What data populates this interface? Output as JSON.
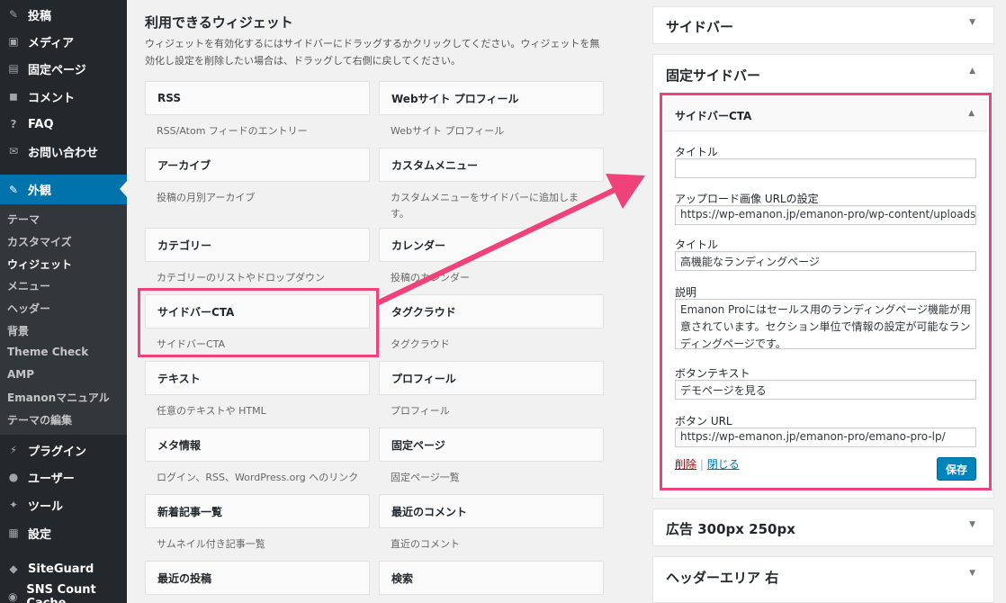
{
  "admin_menu": {
    "items": [
      {
        "icon": "pin-icon",
        "glyph": "✎",
        "label": "投稿"
      },
      {
        "icon": "media-icon",
        "glyph": "▣",
        "label": "メディア"
      },
      {
        "icon": "page-icon",
        "glyph": "▤",
        "label": "固定ページ"
      },
      {
        "icon": "comment-icon",
        "glyph": "◼",
        "label": "コメント"
      },
      {
        "icon": "help-icon",
        "glyph": "?",
        "label": "FAQ"
      },
      {
        "icon": "mail-icon",
        "glyph": "✉",
        "label": "お問い合わせ"
      },
      {
        "icon": "appearance-icon",
        "glyph": "✎",
        "label": "外観"
      },
      {
        "icon": "plugin-icon",
        "glyph": "⚡",
        "label": "プラグイン"
      },
      {
        "icon": "user-icon",
        "glyph": "●",
        "label": "ユーザー"
      },
      {
        "icon": "tool-icon",
        "glyph": "✦",
        "label": "ツール"
      },
      {
        "icon": "settings-icon",
        "glyph": "▦",
        "label": "設定"
      },
      {
        "icon": "siteguard-icon",
        "glyph": "◆",
        "label": "SiteGuard"
      },
      {
        "icon": "sns-icon",
        "glyph": "◉",
        "label": "SNS Count Cache"
      }
    ],
    "submenu": [
      "テーマ",
      "カスタマイズ",
      "ウィジェット",
      "メニュー",
      "ヘッダー",
      "背景",
      "Theme Check",
      "AMP",
      "Emanonマニュアル",
      "テーマの編集"
    ]
  },
  "available": {
    "title": "利用できるウィジェット",
    "description": "ウィジェットを有効化するにはサイドバーにドラッグするかクリックしてください。ウィジェットを無効化し設定を削除したい場合は、ドラッグして右側に戻してください。",
    "widgets": [
      {
        "name": "RSS",
        "desc": "RSS/Atom フィードのエントリー"
      },
      {
        "name": "Webサイト プロフィール",
        "desc": "Webサイト プロフィール"
      },
      {
        "name": "アーカイブ",
        "desc": "投稿の月別アーカイブ"
      },
      {
        "name": "カスタムメニュー",
        "desc": "カスタムメニューをサイドバーに追加しま す。"
      },
      {
        "name": "カテゴリー",
        "desc": "カテゴリーのリストやドロップダウン"
      },
      {
        "name": "カレンダー",
        "desc": "投稿のカレンダー"
      },
      {
        "name": "サイドバーCTA",
        "desc": "サイドバーCTA"
      },
      {
        "name": "タグクラウド",
        "desc": "タグクラウド"
      },
      {
        "name": "テキスト",
        "desc": "任意のテキストや HTML"
      },
      {
        "name": "プロフィール",
        "desc": "プロフィール"
      },
      {
        "name": "メタ情報",
        "desc": "ログイン、RSS、WordPress.org へのリンク"
      },
      {
        "name": "固定ページ",
        "desc": "固定ページ一覧"
      },
      {
        "name": "新着記事一覧",
        "desc": "サムネイル付き記事一覧"
      },
      {
        "name": "最近のコメント",
        "desc": "直近のコメント"
      },
      {
        "name": "最近の投稿",
        "desc": ""
      },
      {
        "name": "検索",
        "desc": ""
      }
    ]
  },
  "areas": {
    "sidebar": "サイドバー",
    "fixed_sidebar": "固定サイドバー",
    "ad": "広告 300px 250px",
    "header_right": "ヘッダーエリア 右"
  },
  "cta_widget": {
    "title": "サイドバーCTA",
    "fields": [
      {
        "label": "タイトル",
        "value": ""
      },
      {
        "label": "アップロード画像 URLの設定",
        "value": "https://wp-emanon.jp/emanon-pro/wp-content/uploads/"
      },
      {
        "label": "タイトル",
        "value": "高機能なランディングページ"
      },
      {
        "label": "説明",
        "value": "Emanon Proにはセールス用のランディングページ機能が用意されています。セクション単位で情報の設定が可能なランディングページです。"
      },
      {
        "label": "ボタンテキスト",
        "value": "デモページを見る"
      },
      {
        "label": "ボタン URL",
        "value": "https://wp-emanon.jp/emanon-pro/emano-pro-lp/"
      }
    ],
    "delete_label": "削除",
    "separator": "|",
    "close_label": "閉じる",
    "save_label": "保存"
  },
  "colors": {
    "accent": "#0073aa",
    "highlight": "#f0427a",
    "admin_bg": "#23282d"
  }
}
